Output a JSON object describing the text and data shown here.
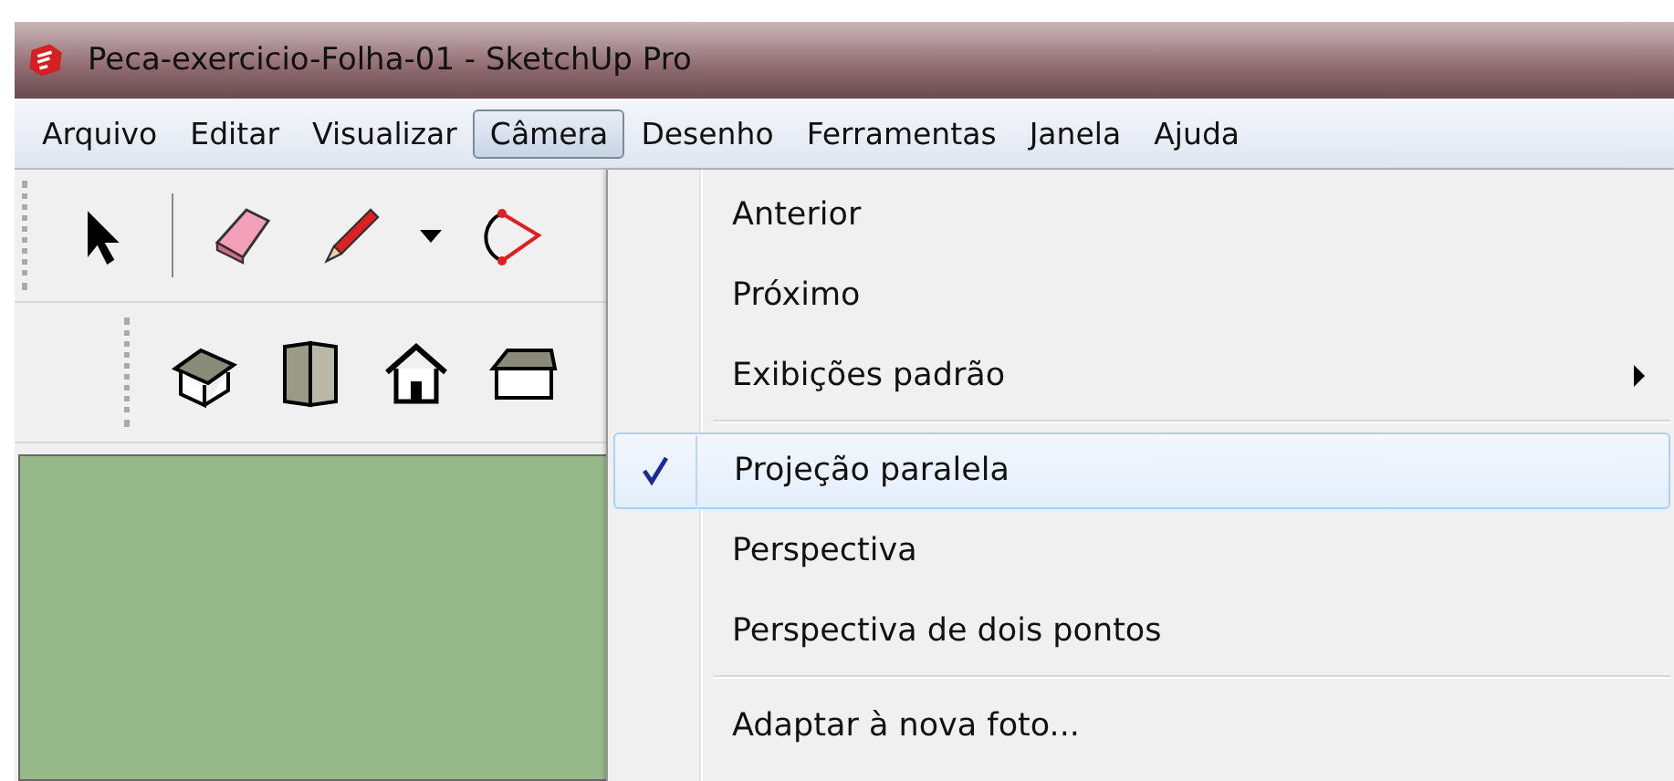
{
  "window": {
    "title": "Peca-exercicio-Folha-01 - SketchUp Pro"
  },
  "menubar": [
    {
      "label": "Arquivo",
      "selected": false
    },
    {
      "label": "Editar",
      "selected": false
    },
    {
      "label": "Visualizar",
      "selected": false
    },
    {
      "label": "Câmera",
      "selected": true
    },
    {
      "label": "Desenho",
      "selected": false
    },
    {
      "label": "Ferramentas",
      "selected": false
    },
    {
      "label": "Janela",
      "selected": false
    },
    {
      "label": "Ajuda",
      "selected": false
    }
  ],
  "menu": [
    {
      "kind": "item",
      "label": "Anterior",
      "checked": false,
      "selected": false,
      "submenu": false
    },
    {
      "kind": "item",
      "label": "Próximo",
      "checked": false,
      "selected": false,
      "submenu": false
    },
    {
      "kind": "item",
      "label": "Exibições padrão",
      "checked": false,
      "selected": false,
      "submenu": true
    },
    {
      "kind": "separator"
    },
    {
      "kind": "item",
      "label": "Projeção paralela",
      "checked": true,
      "selected": true,
      "submenu": false
    },
    {
      "kind": "item",
      "label": "Perspectiva",
      "checked": false,
      "selected": false,
      "submenu": false
    },
    {
      "kind": "item",
      "label": "Perspectiva de dois pontos",
      "checked": false,
      "selected": false,
      "submenu": false
    },
    {
      "kind": "separator"
    },
    {
      "kind": "item",
      "label": "Adaptar à nova foto...",
      "checked": false,
      "selected": false,
      "submenu": false
    }
  ]
}
